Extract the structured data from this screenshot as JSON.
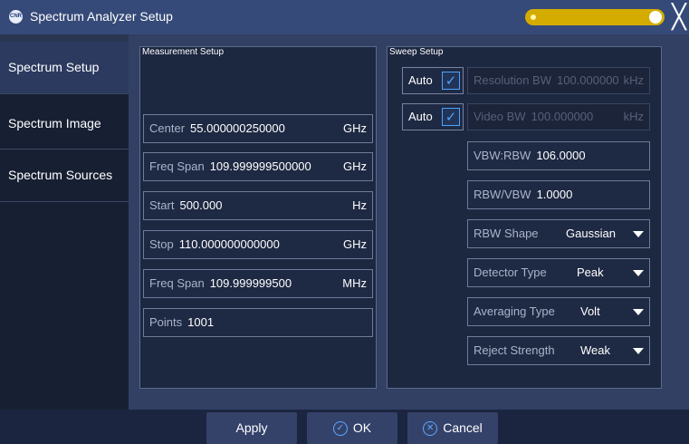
{
  "window": {
    "logo_text": "CNR",
    "title": "Spectrum Analyzer Setup",
    "close_glyph": "╳",
    "toggle_state": "on"
  },
  "sidebar": {
    "items": [
      {
        "label": "Spectrum Setup",
        "active": true
      },
      {
        "label": "Spectrum Image",
        "active": false
      },
      {
        "label": "Spectrum Sources",
        "active": false
      }
    ]
  },
  "measurement": {
    "title": "Measurement Setup",
    "fields": [
      {
        "label": "Center",
        "value": "55.000000250000",
        "unit": "GHz"
      },
      {
        "label": "Freq Span",
        "value": "109.999999500000",
        "unit": "GHz"
      },
      {
        "label": "Start",
        "value": "500.000",
        "unit": "Hz"
      },
      {
        "label": "Stop",
        "value": "110.000000000000",
        "unit": "GHz"
      },
      {
        "label": "Freq Span",
        "value": "109.999999500",
        "unit": "MHz"
      },
      {
        "label": "Points",
        "value": "1001",
        "unit": ""
      }
    ]
  },
  "sweep": {
    "title": "Sweep Setup",
    "auto_label": "Auto",
    "check_glyph": "✓",
    "resolution_bw": {
      "label": "Resolution BW",
      "value": "100.000000",
      "unit": "kHz",
      "auto": true
    },
    "video_bw": {
      "label": "Video BW",
      "value": "100.000000",
      "unit": "kHz",
      "auto": true
    },
    "vbw_rbw": {
      "label": "VBW:RBW",
      "value": "106.0000"
    },
    "rbw_vbw": {
      "label": "RBW/VBW",
      "value": "1.0000"
    },
    "dropdowns": [
      {
        "label": "RBW Shape",
        "value": "Gaussian"
      },
      {
        "label": "Detector Type",
        "value": "Peak"
      },
      {
        "label": "Averaging Type",
        "value": "Volt"
      },
      {
        "label": "Reject Strength",
        "value": "Weak"
      }
    ]
  },
  "footer": {
    "apply_label": "Apply",
    "ok_label": "OK",
    "ok_icon": "✓",
    "cancel_label": "Cancel",
    "cancel_icon": "✕"
  },
  "colors": {
    "accent": "#4da3ff",
    "toggle": "#d4ac00"
  }
}
